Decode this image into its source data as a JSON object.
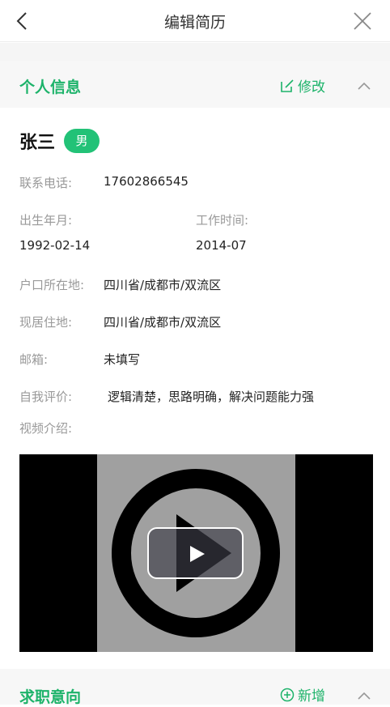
{
  "nav": {
    "title": "编辑简历"
  },
  "personal": {
    "section_title": "个人信息",
    "edit_label": "修改",
    "name": "张三",
    "gender": "男",
    "phone_label": "联系电话:",
    "phone": "17602866545",
    "birth_label": "出生年月:",
    "birth": "1992-02-14",
    "work_label": "工作时间:",
    "work": "2014-07",
    "hukou_label": "户口所在地:",
    "hukou": "四川省/成都市/双流区",
    "residence_label": "现居住地:",
    "residence": "四川省/成都市/双流区",
    "email_label": "邮箱:",
    "email": "未填写",
    "self_eval_label": "自我评价:",
    "self_eval": "逻辑清楚，思路明确，解决问题能力强",
    "video_label": "视频介绍:"
  },
  "job_intent": {
    "section_title": "求职意向",
    "add_label": "新增"
  },
  "colors": {
    "accent": "#1db36a",
    "badge": "#22c277"
  }
}
